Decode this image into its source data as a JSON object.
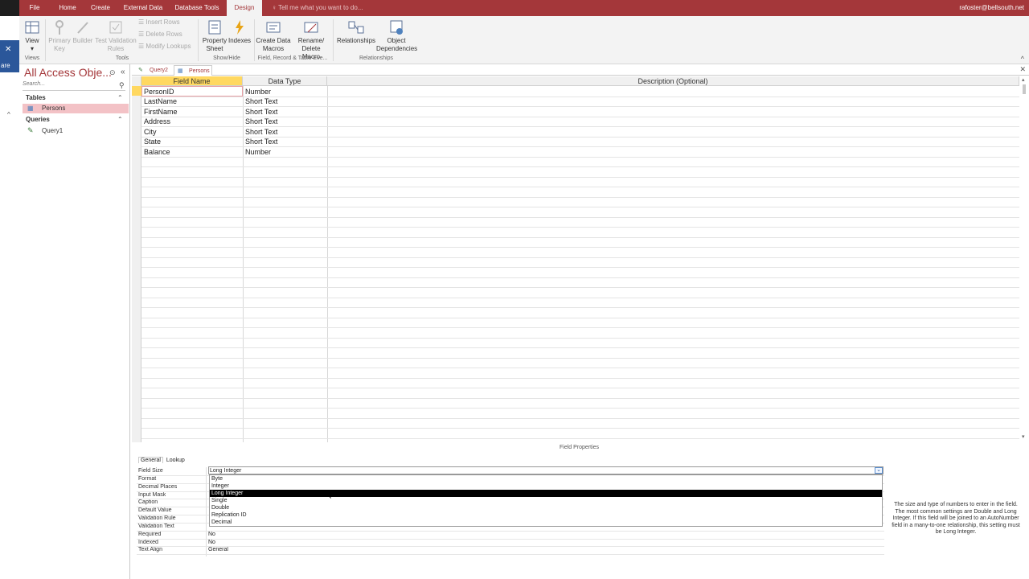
{
  "menu": {
    "tabs": [
      "File",
      "Home",
      "Create",
      "External Data",
      "Database Tools",
      "Design"
    ],
    "active": "Design",
    "tell_me": "Tell me what you want to do...",
    "user": "rafoster@bellsouth.net"
  },
  "left_strip": {
    "text": "are"
  },
  "ribbon": {
    "view": "View",
    "primary_key": "Primary Key",
    "builder": "Builder",
    "test_validation": "Test Validation Rules",
    "insert_rows": "Insert Rows",
    "delete_rows": "Delete Rows",
    "modify_lookups": "Modify Lookups",
    "property_sheet": "Property Sheet",
    "indexes": "Indexes",
    "create_data_macros": "Create Data Macros",
    "rename_delete_macro": "Rename/ Delete Macro",
    "relationships": "Relationships",
    "object_dependencies": "Object Dependencies",
    "groups": {
      "views": "Views",
      "tools": "Tools",
      "show_hide": "Show/Hide",
      "field_record": "Field, Record & Table Eve...",
      "relationships": "Relationships"
    }
  },
  "nav": {
    "title": "All Access Obje...",
    "search_placeholder": "Search...",
    "tables_label": "Tables",
    "tables": [
      "Persons"
    ],
    "queries_label": "Queries",
    "queries": [
      "Query1"
    ]
  },
  "doc_tabs": [
    "Query2",
    "Persons"
  ],
  "grid": {
    "headers": {
      "field_name": "Field Name",
      "data_type": "Data Type",
      "description": "Description (Optional)"
    },
    "rows": [
      {
        "name": "PersonID",
        "type": "Number"
      },
      {
        "name": "LastName",
        "type": "Short Text"
      },
      {
        "name": "FirstName",
        "type": "Short Text"
      },
      {
        "name": "Address",
        "type": "Short Text"
      },
      {
        "name": "City",
        "type": "Short Text"
      },
      {
        "name": "State",
        "type": "Short Text"
      },
      {
        "name": "Balance",
        "type": "Number"
      }
    ]
  },
  "field_properties": {
    "title": "Field Properties",
    "tab_general": "General",
    "tab_lookup": "Lookup",
    "labels": [
      "Field Size",
      "Format",
      "Decimal Places",
      "Input Mask",
      "Caption",
      "Default Value",
      "Validation Rule",
      "Validation Text",
      "Required",
      "Indexed",
      "Text Align"
    ],
    "field_size_value": "Long Integer",
    "required": "No",
    "indexed": "No",
    "text_align": "General",
    "dropdown_options": [
      "Byte",
      "Integer",
      "Long Integer",
      "Single",
      "Double",
      "Replication ID",
      "Decimal"
    ],
    "dropdown_selected": "Long Integer",
    "help": "The size and type of numbers to enter in the field. The most common settings are Double and Long Integer. If this field will be joined to an AutoNumber field in a many-to-one relationship, this setting must be Long Integer."
  }
}
